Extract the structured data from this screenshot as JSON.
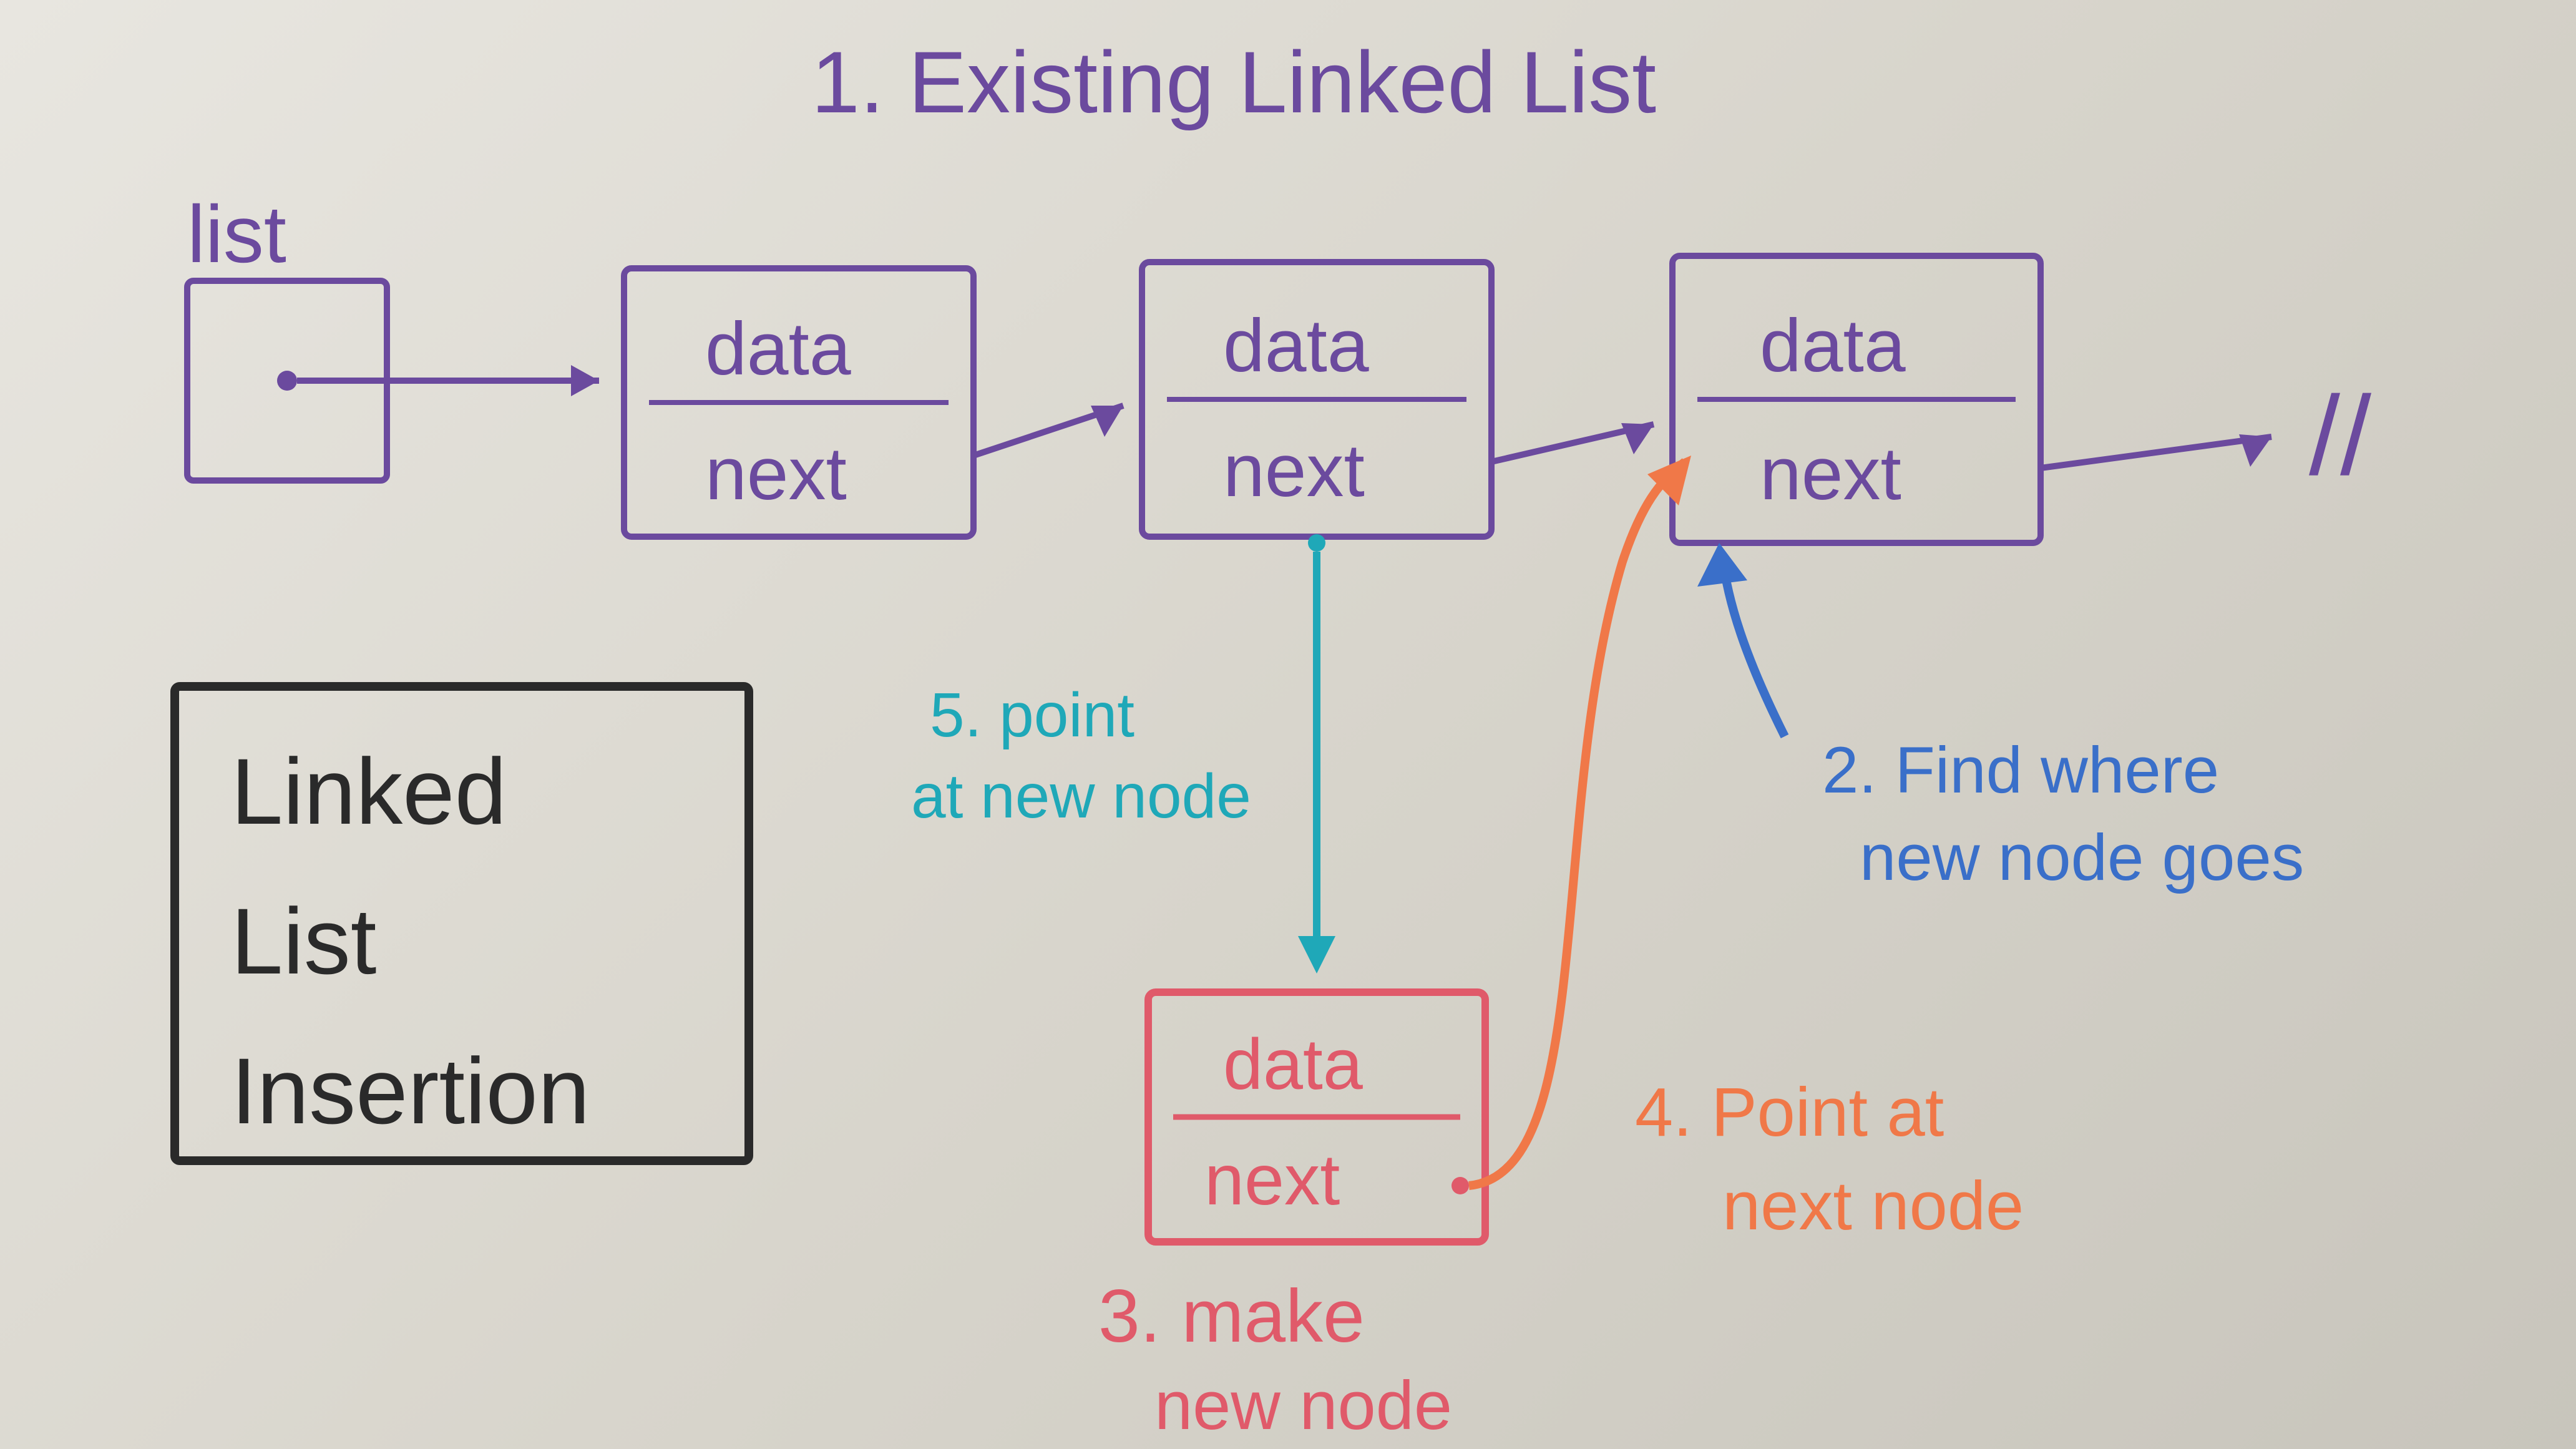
{
  "title": "1. Existing Linked List",
  "list_label": "list",
  "node_fields": {
    "data": "data",
    "next": "next"
  },
  "null_symbol": "//",
  "legend": {
    "line1": "Linked",
    "line2": "List",
    "line3": "Insertion"
  },
  "steps": {
    "step2": "2. Find where new node goes",
    "step3": "3. make new node",
    "step4": "4. Point at next node",
    "step5": "5. point at new node"
  },
  "colors": {
    "purple": "#6b4a9e",
    "black": "#2a2a2a",
    "teal": "#1fa8b8",
    "blue": "#3a6fc9",
    "orange": "#f07848",
    "red": "#e05a6a"
  }
}
